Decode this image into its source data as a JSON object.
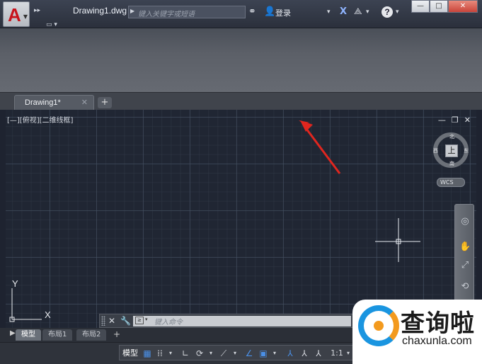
{
  "titlebar": {
    "doc_title": "Drawing1.dwg",
    "search_placeholder": "键入关键字或短语",
    "login_label": "登录",
    "window_buttons": {
      "minimize": "—",
      "maximize": "□",
      "close": "✕"
    },
    "icons": [
      "binoculars-icon",
      "user-icon",
      "exchange-icon",
      "a360-icon",
      "help-icon"
    ]
  },
  "doc_tabs": {
    "active_label": "Drawing1*",
    "close_glyph": "✕",
    "new_glyph": "+"
  },
  "viewport": {
    "label": "[—][俯视][二维线框]",
    "controls": {
      "minimize": "—",
      "restore": "❐",
      "close": "✕"
    }
  },
  "viewcube": {
    "face": "上",
    "north": "北",
    "south": "南",
    "west": "西",
    "east": "东",
    "wcs": "WCS"
  },
  "ucs": {
    "y": "Y",
    "x": "X"
  },
  "command_line": {
    "placeholder": "键入命令"
  },
  "layout_tabs": [
    "模型",
    "布局1",
    "布局2"
  ],
  "statusbar": {
    "model": "模型",
    "scale": "1:1"
  },
  "watermark": {
    "cn": "查询啦",
    "en": "chaxunla.com"
  },
  "colors": {
    "accent": "#1a95e0",
    "annotation": "#e0261f",
    "drawing_bg": "#202633"
  }
}
